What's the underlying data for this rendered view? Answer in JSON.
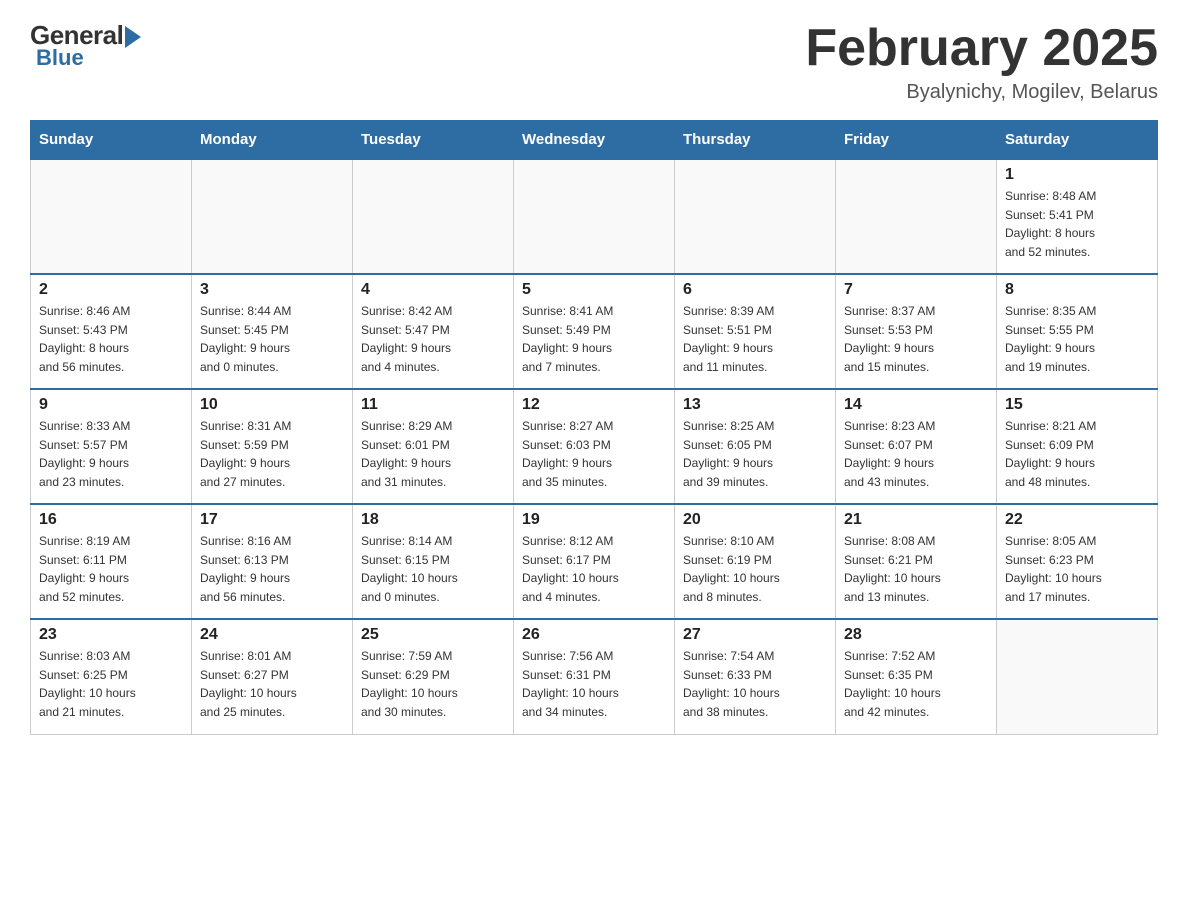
{
  "header": {
    "logo_general": "General",
    "logo_blue": "Blue",
    "title": "February 2025",
    "subtitle": "Byalynichy, Mogilev, Belarus"
  },
  "days_of_week": [
    "Sunday",
    "Monday",
    "Tuesday",
    "Wednesday",
    "Thursday",
    "Friday",
    "Saturday"
  ],
  "weeks": [
    [
      {
        "day": "",
        "info": ""
      },
      {
        "day": "",
        "info": ""
      },
      {
        "day": "",
        "info": ""
      },
      {
        "day": "",
        "info": ""
      },
      {
        "day": "",
        "info": ""
      },
      {
        "day": "",
        "info": ""
      },
      {
        "day": "1",
        "info": "Sunrise: 8:48 AM\nSunset: 5:41 PM\nDaylight: 8 hours\nand 52 minutes."
      }
    ],
    [
      {
        "day": "2",
        "info": "Sunrise: 8:46 AM\nSunset: 5:43 PM\nDaylight: 8 hours\nand 56 minutes."
      },
      {
        "day": "3",
        "info": "Sunrise: 8:44 AM\nSunset: 5:45 PM\nDaylight: 9 hours\nand 0 minutes."
      },
      {
        "day": "4",
        "info": "Sunrise: 8:42 AM\nSunset: 5:47 PM\nDaylight: 9 hours\nand 4 minutes."
      },
      {
        "day": "5",
        "info": "Sunrise: 8:41 AM\nSunset: 5:49 PM\nDaylight: 9 hours\nand 7 minutes."
      },
      {
        "day": "6",
        "info": "Sunrise: 8:39 AM\nSunset: 5:51 PM\nDaylight: 9 hours\nand 11 minutes."
      },
      {
        "day": "7",
        "info": "Sunrise: 8:37 AM\nSunset: 5:53 PM\nDaylight: 9 hours\nand 15 minutes."
      },
      {
        "day": "8",
        "info": "Sunrise: 8:35 AM\nSunset: 5:55 PM\nDaylight: 9 hours\nand 19 minutes."
      }
    ],
    [
      {
        "day": "9",
        "info": "Sunrise: 8:33 AM\nSunset: 5:57 PM\nDaylight: 9 hours\nand 23 minutes."
      },
      {
        "day": "10",
        "info": "Sunrise: 8:31 AM\nSunset: 5:59 PM\nDaylight: 9 hours\nand 27 minutes."
      },
      {
        "day": "11",
        "info": "Sunrise: 8:29 AM\nSunset: 6:01 PM\nDaylight: 9 hours\nand 31 minutes."
      },
      {
        "day": "12",
        "info": "Sunrise: 8:27 AM\nSunset: 6:03 PM\nDaylight: 9 hours\nand 35 minutes."
      },
      {
        "day": "13",
        "info": "Sunrise: 8:25 AM\nSunset: 6:05 PM\nDaylight: 9 hours\nand 39 minutes."
      },
      {
        "day": "14",
        "info": "Sunrise: 8:23 AM\nSunset: 6:07 PM\nDaylight: 9 hours\nand 43 minutes."
      },
      {
        "day": "15",
        "info": "Sunrise: 8:21 AM\nSunset: 6:09 PM\nDaylight: 9 hours\nand 48 minutes."
      }
    ],
    [
      {
        "day": "16",
        "info": "Sunrise: 8:19 AM\nSunset: 6:11 PM\nDaylight: 9 hours\nand 52 minutes."
      },
      {
        "day": "17",
        "info": "Sunrise: 8:16 AM\nSunset: 6:13 PM\nDaylight: 9 hours\nand 56 minutes."
      },
      {
        "day": "18",
        "info": "Sunrise: 8:14 AM\nSunset: 6:15 PM\nDaylight: 10 hours\nand 0 minutes."
      },
      {
        "day": "19",
        "info": "Sunrise: 8:12 AM\nSunset: 6:17 PM\nDaylight: 10 hours\nand 4 minutes."
      },
      {
        "day": "20",
        "info": "Sunrise: 8:10 AM\nSunset: 6:19 PM\nDaylight: 10 hours\nand 8 minutes."
      },
      {
        "day": "21",
        "info": "Sunrise: 8:08 AM\nSunset: 6:21 PM\nDaylight: 10 hours\nand 13 minutes."
      },
      {
        "day": "22",
        "info": "Sunrise: 8:05 AM\nSunset: 6:23 PM\nDaylight: 10 hours\nand 17 minutes."
      }
    ],
    [
      {
        "day": "23",
        "info": "Sunrise: 8:03 AM\nSunset: 6:25 PM\nDaylight: 10 hours\nand 21 minutes."
      },
      {
        "day": "24",
        "info": "Sunrise: 8:01 AM\nSunset: 6:27 PM\nDaylight: 10 hours\nand 25 minutes."
      },
      {
        "day": "25",
        "info": "Sunrise: 7:59 AM\nSunset: 6:29 PM\nDaylight: 10 hours\nand 30 minutes."
      },
      {
        "day": "26",
        "info": "Sunrise: 7:56 AM\nSunset: 6:31 PM\nDaylight: 10 hours\nand 34 minutes."
      },
      {
        "day": "27",
        "info": "Sunrise: 7:54 AM\nSunset: 6:33 PM\nDaylight: 10 hours\nand 38 minutes."
      },
      {
        "day": "28",
        "info": "Sunrise: 7:52 AM\nSunset: 6:35 PM\nDaylight: 10 hours\nand 42 minutes."
      },
      {
        "day": "",
        "info": ""
      }
    ]
  ]
}
